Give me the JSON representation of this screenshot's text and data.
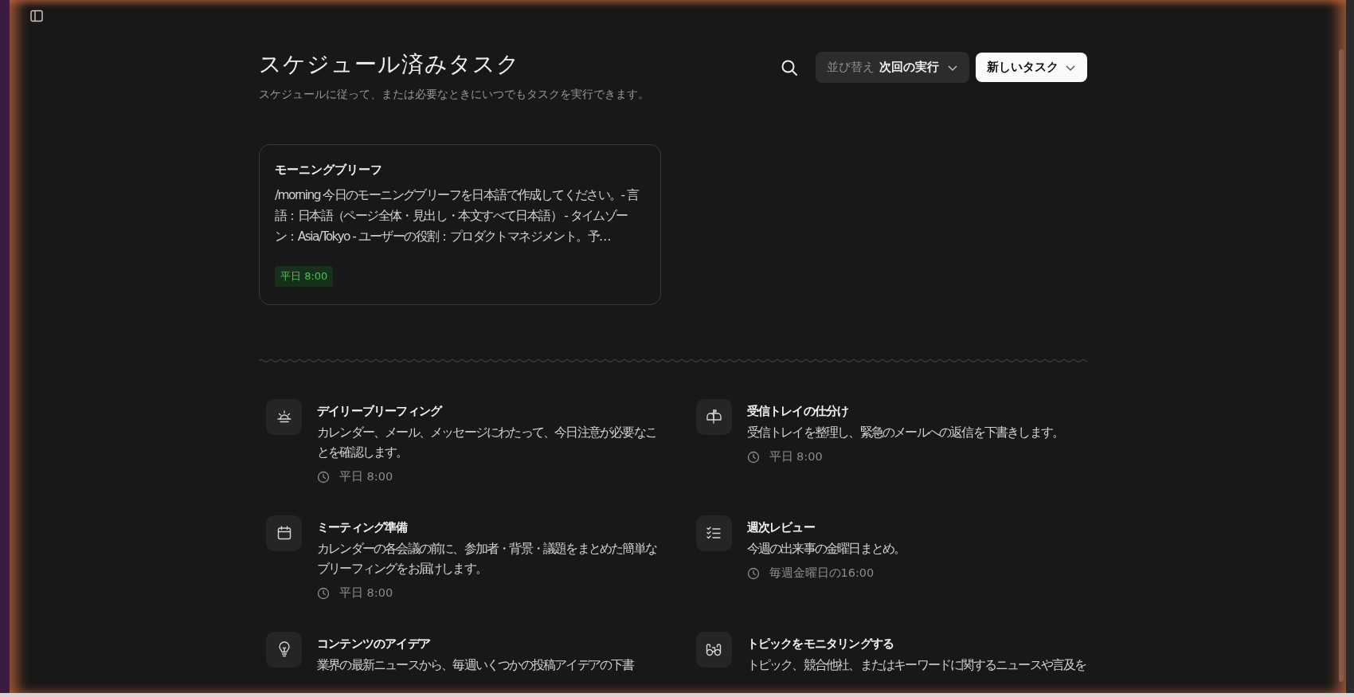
{
  "header": {
    "title": "スケジュール済みタスク",
    "subtitle": "スケジュールに従って、または必要なときにいつでもタスクを実行できます。"
  },
  "sort": {
    "label": "並び替え",
    "value": "次回の実行"
  },
  "new_task_button": {
    "label": "新しいタスク"
  },
  "tasks": [
    {
      "title": "モーニングブリーフ",
      "prompt": "/morning 今日のモーニングブリーフを日本語で作成してください。- 言語：日本語（ページ全体・見出し・本文すべて日本語） - タイムゾーン：Asia/Tokyo - ユーザーの役割：プロダクトマネジメント。予…",
      "schedule": "平日 8:00"
    }
  ],
  "templates": [
    {
      "title": "デイリーブリーフィング",
      "description": "カレンダー、メール、メッセージにわたって、今日注意が必要なことを確認します。",
      "schedule": "平日 8:00"
    },
    {
      "title": "受信トレイの仕分け",
      "description": "受信トレイを整理し、緊急のメールへの返信を下書きします。",
      "schedule": "平日 8:00"
    },
    {
      "title": "ミーティング準備",
      "description": "カレンダーの各会議の前に、参加者・背景・議題をまとめた簡単なブリーフィングをお届けします。",
      "schedule": "平日 8:00"
    },
    {
      "title": "週次レビュー",
      "description": "今週の出来事の金曜日まとめ。",
      "schedule": "毎週金曜日の16:00"
    },
    {
      "title": "コンテンツのアイデア",
      "description": "業界の最新ニュースから、毎週いくつかの投稿アイデアの下書"
    },
    {
      "title": "トピックをモニタリングする",
      "description": "トピック、競合他社、またはキーワードに関するニュースや言及を"
    }
  ]
}
